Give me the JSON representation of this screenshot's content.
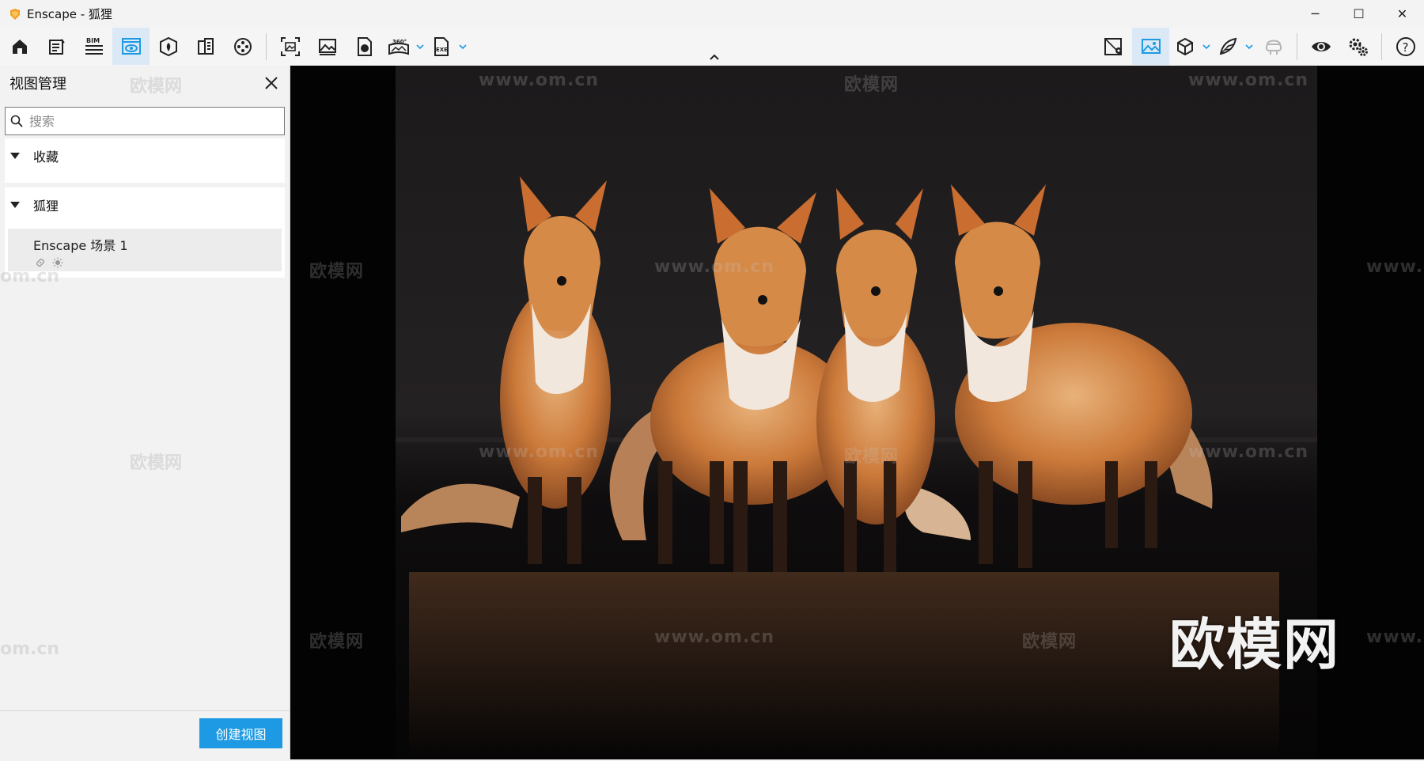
{
  "window": {
    "title": "Enscape - 狐狸",
    "minimize": "─",
    "maximize": "☐",
    "close": "✕"
  },
  "toolbar": {
    "left_icons": [
      "home-icon",
      "document-edit-icon",
      "bim-icon",
      "view-manager-icon",
      "asset-library-icon",
      "material-editor-icon",
      "video-editor-icon",
      "screenshot-icon",
      "gallery-icon",
      "export-icon",
      "panorama-360-icon",
      "exe-export-icon"
    ],
    "bim_label": "BIM",
    "pano_label": "360°",
    "exe_label": "EXE",
    "right_icons": [
      "map-view-icon",
      "visual-settings-icon",
      "cube-view-icon",
      "feather-icon",
      "vr-headset-icon",
      "eye-icon",
      "settings-icon",
      "help-icon"
    ],
    "help_label": "?"
  },
  "panel": {
    "title": "视图管理",
    "search": {
      "placeholder": "搜索",
      "value": ""
    },
    "sections": [
      {
        "label": "收藏"
      },
      {
        "label": "狐狸"
      }
    ],
    "views": [
      {
        "name": "Enscape 场景 1"
      }
    ],
    "create_button": "创建视图"
  },
  "viewport": {
    "watermark_brand": "欧模网",
    "watermark_url": "www.om.cn",
    "watermark_url_short": "om.cn",
    "overlay_text": "欧模网"
  },
  "colors": {
    "accent": "#1d9ae3",
    "active_tool_bg": "#dbe9f7"
  }
}
